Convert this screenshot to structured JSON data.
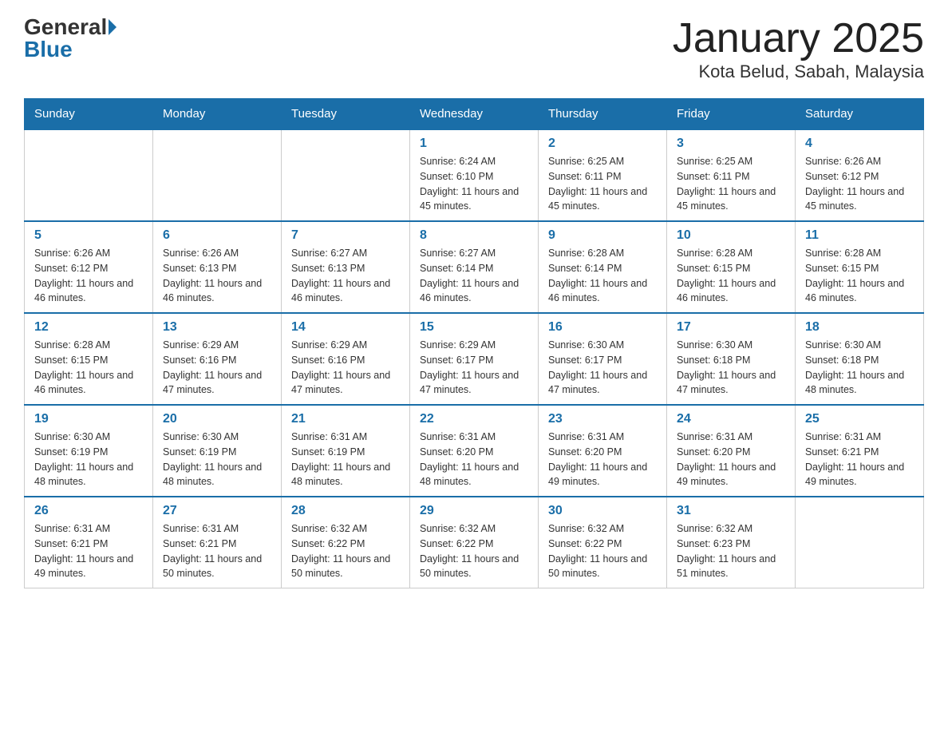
{
  "header": {
    "logo_general": "General",
    "logo_blue": "Blue",
    "month_title": "January 2025",
    "location": "Kota Belud, Sabah, Malaysia"
  },
  "weekdays": [
    "Sunday",
    "Monday",
    "Tuesday",
    "Wednesday",
    "Thursday",
    "Friday",
    "Saturday"
  ],
  "weeks": [
    [
      {
        "day": "",
        "info": ""
      },
      {
        "day": "",
        "info": ""
      },
      {
        "day": "",
        "info": ""
      },
      {
        "day": "1",
        "info": "Sunrise: 6:24 AM\nSunset: 6:10 PM\nDaylight: 11 hours and 45 minutes."
      },
      {
        "day": "2",
        "info": "Sunrise: 6:25 AM\nSunset: 6:11 PM\nDaylight: 11 hours and 45 minutes."
      },
      {
        "day": "3",
        "info": "Sunrise: 6:25 AM\nSunset: 6:11 PM\nDaylight: 11 hours and 45 minutes."
      },
      {
        "day": "4",
        "info": "Sunrise: 6:26 AM\nSunset: 6:12 PM\nDaylight: 11 hours and 45 minutes."
      }
    ],
    [
      {
        "day": "5",
        "info": "Sunrise: 6:26 AM\nSunset: 6:12 PM\nDaylight: 11 hours and 46 minutes."
      },
      {
        "day": "6",
        "info": "Sunrise: 6:26 AM\nSunset: 6:13 PM\nDaylight: 11 hours and 46 minutes."
      },
      {
        "day": "7",
        "info": "Sunrise: 6:27 AM\nSunset: 6:13 PM\nDaylight: 11 hours and 46 minutes."
      },
      {
        "day": "8",
        "info": "Sunrise: 6:27 AM\nSunset: 6:14 PM\nDaylight: 11 hours and 46 minutes."
      },
      {
        "day": "9",
        "info": "Sunrise: 6:28 AM\nSunset: 6:14 PM\nDaylight: 11 hours and 46 minutes."
      },
      {
        "day": "10",
        "info": "Sunrise: 6:28 AM\nSunset: 6:15 PM\nDaylight: 11 hours and 46 minutes."
      },
      {
        "day": "11",
        "info": "Sunrise: 6:28 AM\nSunset: 6:15 PM\nDaylight: 11 hours and 46 minutes."
      }
    ],
    [
      {
        "day": "12",
        "info": "Sunrise: 6:28 AM\nSunset: 6:15 PM\nDaylight: 11 hours and 46 minutes."
      },
      {
        "day": "13",
        "info": "Sunrise: 6:29 AM\nSunset: 6:16 PM\nDaylight: 11 hours and 47 minutes."
      },
      {
        "day": "14",
        "info": "Sunrise: 6:29 AM\nSunset: 6:16 PM\nDaylight: 11 hours and 47 minutes."
      },
      {
        "day": "15",
        "info": "Sunrise: 6:29 AM\nSunset: 6:17 PM\nDaylight: 11 hours and 47 minutes."
      },
      {
        "day": "16",
        "info": "Sunrise: 6:30 AM\nSunset: 6:17 PM\nDaylight: 11 hours and 47 minutes."
      },
      {
        "day": "17",
        "info": "Sunrise: 6:30 AM\nSunset: 6:18 PM\nDaylight: 11 hours and 47 minutes."
      },
      {
        "day": "18",
        "info": "Sunrise: 6:30 AM\nSunset: 6:18 PM\nDaylight: 11 hours and 48 minutes."
      }
    ],
    [
      {
        "day": "19",
        "info": "Sunrise: 6:30 AM\nSunset: 6:19 PM\nDaylight: 11 hours and 48 minutes."
      },
      {
        "day": "20",
        "info": "Sunrise: 6:30 AM\nSunset: 6:19 PM\nDaylight: 11 hours and 48 minutes."
      },
      {
        "day": "21",
        "info": "Sunrise: 6:31 AM\nSunset: 6:19 PM\nDaylight: 11 hours and 48 minutes."
      },
      {
        "day": "22",
        "info": "Sunrise: 6:31 AM\nSunset: 6:20 PM\nDaylight: 11 hours and 48 minutes."
      },
      {
        "day": "23",
        "info": "Sunrise: 6:31 AM\nSunset: 6:20 PM\nDaylight: 11 hours and 49 minutes."
      },
      {
        "day": "24",
        "info": "Sunrise: 6:31 AM\nSunset: 6:20 PM\nDaylight: 11 hours and 49 minutes."
      },
      {
        "day": "25",
        "info": "Sunrise: 6:31 AM\nSunset: 6:21 PM\nDaylight: 11 hours and 49 minutes."
      }
    ],
    [
      {
        "day": "26",
        "info": "Sunrise: 6:31 AM\nSunset: 6:21 PM\nDaylight: 11 hours and 49 minutes."
      },
      {
        "day": "27",
        "info": "Sunrise: 6:31 AM\nSunset: 6:21 PM\nDaylight: 11 hours and 50 minutes."
      },
      {
        "day": "28",
        "info": "Sunrise: 6:32 AM\nSunset: 6:22 PM\nDaylight: 11 hours and 50 minutes."
      },
      {
        "day": "29",
        "info": "Sunrise: 6:32 AM\nSunset: 6:22 PM\nDaylight: 11 hours and 50 minutes."
      },
      {
        "day": "30",
        "info": "Sunrise: 6:32 AM\nSunset: 6:22 PM\nDaylight: 11 hours and 50 minutes."
      },
      {
        "day": "31",
        "info": "Sunrise: 6:32 AM\nSunset: 6:23 PM\nDaylight: 11 hours and 51 minutes."
      },
      {
        "day": "",
        "info": ""
      }
    ]
  ]
}
